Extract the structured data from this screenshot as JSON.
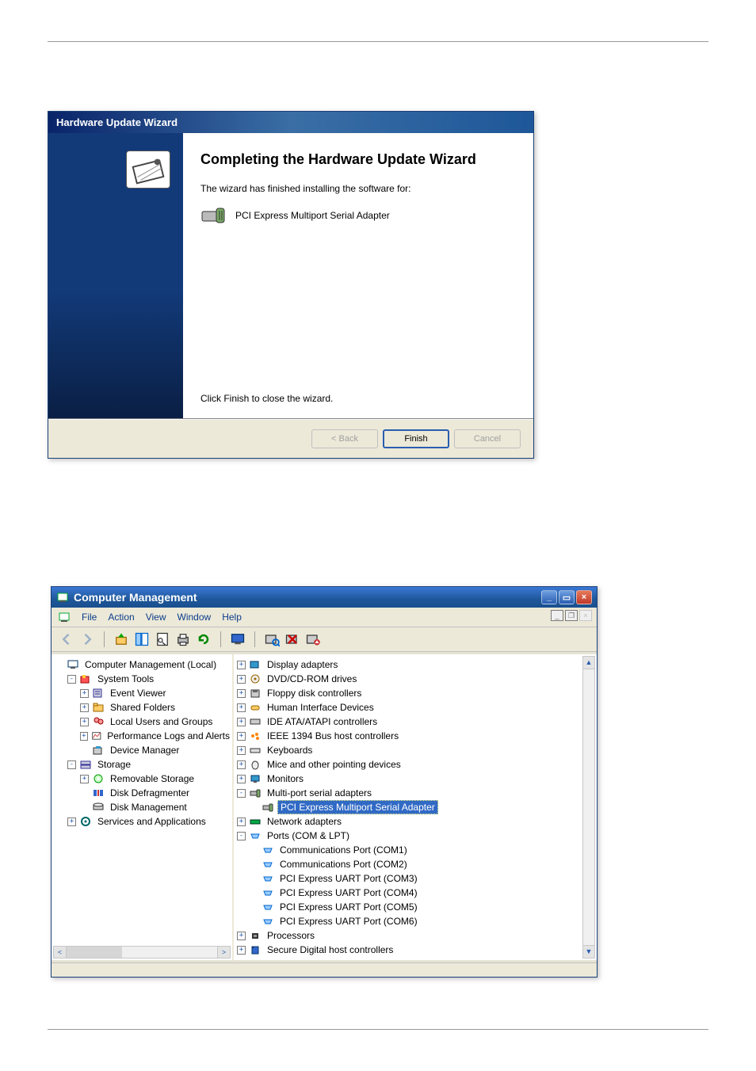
{
  "wizard": {
    "title": "Hardware Update Wizard",
    "heading": "Completing the Hardware Update Wizard",
    "subtext": "The wizard has finished installing the software for:",
    "device_name": "PCI Express Multiport Serial Adapter",
    "close_text": "Click Finish to close the wizard.",
    "buttons": {
      "back": "< Back",
      "finish": "Finish",
      "cancel": "Cancel"
    }
  },
  "mmc": {
    "title": "Computer Management",
    "menu": {
      "file": "File",
      "action": "Action",
      "view": "View",
      "window": "Window",
      "help": "Help"
    },
    "tree": {
      "root": "Computer Management (Local)",
      "system_tools": "System Tools",
      "event_viewer": "Event Viewer",
      "shared_folders": "Shared Folders",
      "local_users": "Local Users and Groups",
      "perf_logs": "Performance Logs and Alerts",
      "device_manager": "Device Manager",
      "storage": "Storage",
      "removable": "Removable Storage",
      "defrag": "Disk Defragmenter",
      "diskmgmt": "Disk Management",
      "services_apps": "Services and Applications"
    },
    "devices": {
      "display": "Display adapters",
      "dvd": "DVD/CD-ROM drives",
      "floppy": "Floppy disk controllers",
      "hid": "Human Interface Devices",
      "ide": "IDE ATA/ATAPI controllers",
      "ieee1394": "IEEE 1394 Bus host controllers",
      "keyboards": "Keyboards",
      "mice": "Mice and other pointing devices",
      "monitors": "Monitors",
      "multiport": "Multi-port serial adapters",
      "multiport_sel": "PCI Express Multiport Serial Adapter",
      "network": "Network adapters",
      "ports": "Ports (COM & LPT)",
      "com1": "Communications Port (COM1)",
      "com2": "Communications Port (COM2)",
      "com3": "PCI Express UART Port (COM3)",
      "com4": "PCI Express UART Port (COM4)",
      "com5": "PCI Express UART Port (COM5)",
      "com6": "PCI Express UART Port (COM6)",
      "processors": "Processors",
      "sd": "Secure Digital host controllers"
    }
  }
}
